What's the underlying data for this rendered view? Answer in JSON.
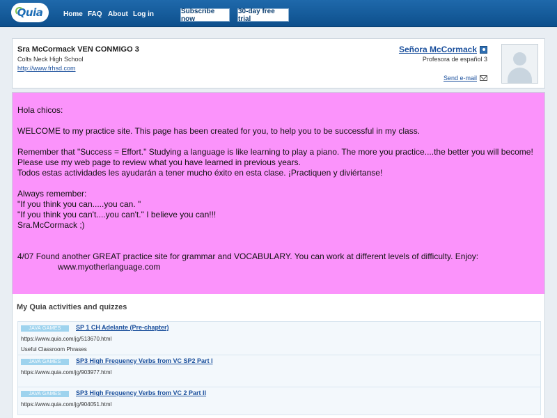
{
  "topbar": {
    "logo_text": "Quia",
    "nav": [
      "Home",
      "FAQ",
      "About",
      "Log in"
    ],
    "subscribe_label": "Subscribe now",
    "trial_label": "30-day free trial",
    "colors": {
      "bar": "#1f69ab",
      "text": "#ffffff"
    }
  },
  "profile": {
    "title": "Sra McCormack VEN CONMIGO 3",
    "school": "Colts Neck High School",
    "url": "http://www.frhsd.com",
    "name": "Señora McCormack",
    "role": "Profesora de español 3",
    "email_label": "Send e-mail"
  },
  "message": {
    "background": "#fb93fb",
    "lines": [
      "Hola chicos:",
      "",
      "WELCOME to my practice site. This page has been created for you, to help you to be successful in my class.",
      "",
      "Remember that \"Success = Effort.\" Studying a language is like learning to play a piano. The more you practice....the better you will become!",
      "Please use my web page to review what you have learned in previous years.",
      "Todos estas actividades les ayudarán a tener mucho éxito en esta clase. ¡Practiquen y diviértanse!",
      "",
      "Always remember:",
      "\"If you think you can.....you can.   \"",
      "\"If you think you can't....you can't.\" I believe you can!!!",
      "Sra.McCormack ;)",
      "",
      "",
      "4/07 Found another GREAT practice site for grammar and VOCABULARY.  You can work at different levels of difficulty. Enjoy:",
      "www.myotherlanguage.com"
    ]
  },
  "activities": {
    "section_title": "My Quia activities and quizzes",
    "items": [
      {
        "badge": "JAVA GAMES",
        "title": "SP 1 CH Adelante (Pre-chapter)",
        "url": "https://www.quia.com/jg/513670.html",
        "description": "Useful Classroom Phrases"
      },
      {
        "badge": "JAVA GAMES",
        "title": "SP3 High Frequency Verbs from VC SP2 Part I",
        "url": "https://www.quia.com/jg/903977.html"
      },
      {
        "badge": "JAVA GAMES",
        "title": "SP3 High Frequency Verbs from VC 2 Part II",
        "url": "https://www.quia.com/jg/904051.html"
      }
    ]
  }
}
